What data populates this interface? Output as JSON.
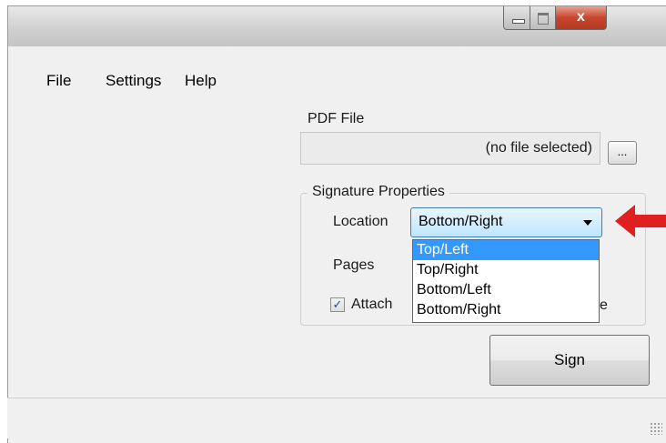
{
  "window": {
    "minimize_glyph": "",
    "maximize_glyph": "",
    "close_glyph": "x"
  },
  "menu": {
    "file": "File",
    "settings": "Settings",
    "help": "Help"
  },
  "pdf": {
    "label": "PDF File",
    "value": "(no file selected)",
    "browse_label": "..."
  },
  "signature": {
    "group_title": "Signature Properties",
    "location_label": "Location",
    "location_value": "Bottom/Right",
    "location_options": [
      "Top/Left",
      "Top/Right",
      "Bottom/Left",
      "Bottom/Right"
    ],
    "highlighted_option": "Top/Left",
    "pages_label": "Pages",
    "attach_label": "Attach",
    "attach_checked": true,
    "clipped_suffix": "e"
  },
  "actions": {
    "sign_label": "Sign"
  },
  "colors": {
    "highlight": "#3399ff",
    "pointer_arrow": "#e02020",
    "close_button": "#c8452c"
  },
  "icons": {
    "pointer": "red-arrow-icon",
    "dropdown": "chevron-down-icon",
    "resize": "resize-grip-icon"
  }
}
